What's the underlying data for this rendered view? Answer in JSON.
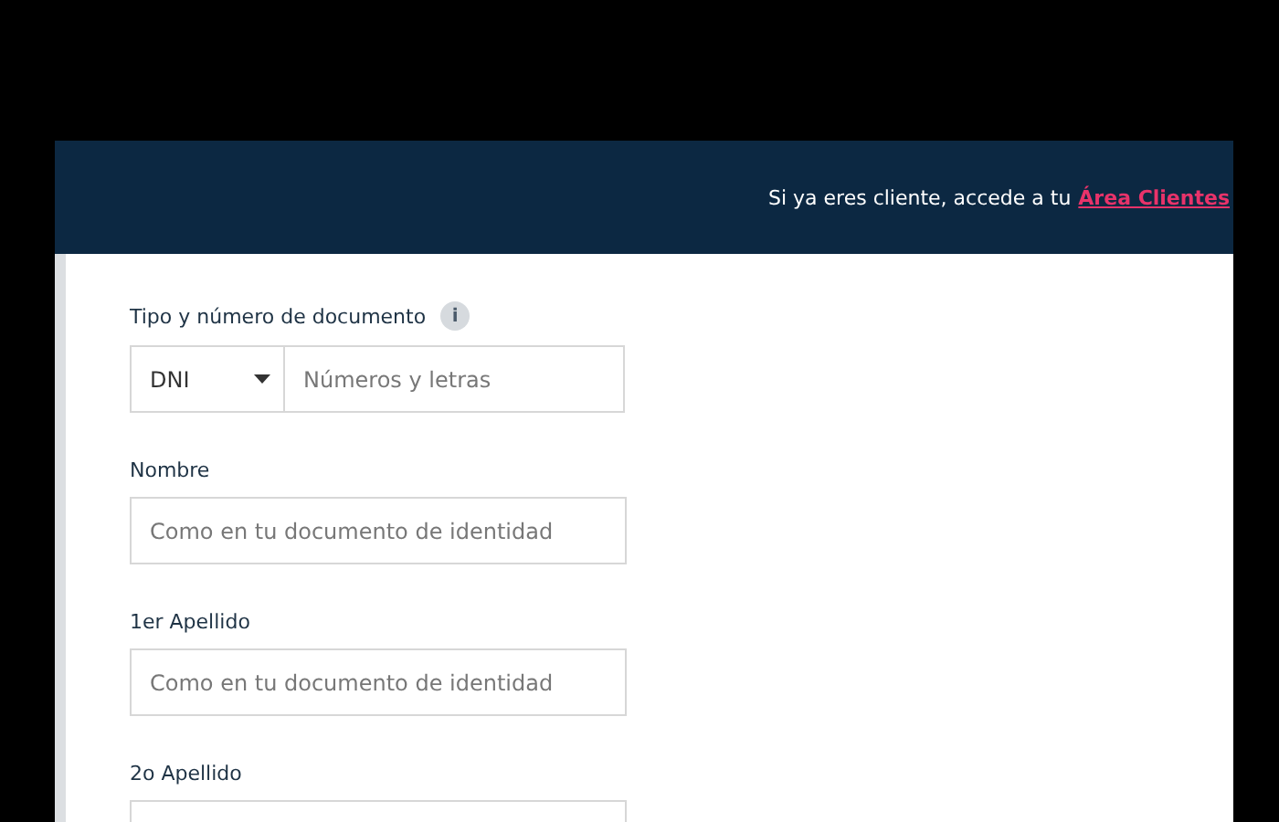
{
  "header": {
    "text": "Si ya eres cliente, accede a tu",
    "link": "Área Clientes"
  },
  "document": {
    "label": "Tipo y número de documento",
    "info_icon": "i",
    "type": "DNI",
    "placeholder": "Números y letras"
  },
  "fields": [
    {
      "label": "Nombre",
      "placeholder": "Como en tu documento de identidad"
    },
    {
      "label": "1er Apellido",
      "placeholder": "Como en tu documento de identidad"
    },
    {
      "label": "2o Apellido"
    }
  ]
}
